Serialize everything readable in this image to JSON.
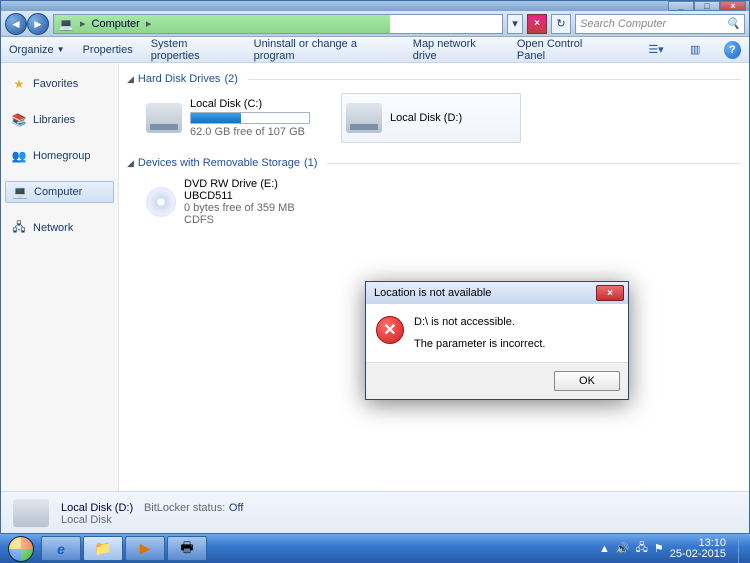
{
  "window_controls": {
    "min": "_",
    "max": "□",
    "close": "×"
  },
  "nav": {
    "back": "◄",
    "forward": "►",
    "crumbs": [
      "Computer"
    ],
    "refresh": "↻",
    "stop": "×"
  },
  "search": {
    "placeholder": "Search Computer",
    "icon": "🔍"
  },
  "toolbar": {
    "organize": "Organize",
    "properties": "Properties",
    "system_properties": "System properties",
    "uninstall": "Uninstall or change a program",
    "map_drive": "Map network drive",
    "control_panel": "Open Control Panel",
    "help": "?"
  },
  "sidebar": {
    "favorites": {
      "label": "Favorites",
      "icon": "★"
    },
    "libraries": {
      "label": "Libraries",
      "icon": "📚"
    },
    "homegroup": {
      "label": "Homegroup",
      "icon": "👥"
    },
    "computer": {
      "label": "Computer",
      "icon": "💻"
    },
    "network": {
      "label": "Network",
      "icon": "🖧"
    }
  },
  "groups": {
    "hdd": {
      "label": "Hard Disk Drives",
      "count": "(2)"
    },
    "removable": {
      "label": "Devices with Removable Storage",
      "count": "(1)"
    }
  },
  "drives": {
    "c": {
      "name": "Local Disk (C:)",
      "free": "62.0 GB free of 107 GB",
      "fill_pct": 42
    },
    "d": {
      "name": "Local Disk (D:)"
    },
    "dvd": {
      "name": "DVD RW Drive (E:) UBCD511",
      "free": "0 bytes free of 359 MB",
      "fs": "CDFS"
    }
  },
  "dialog": {
    "title": "Location is not available",
    "line1": "D:\\ is not accessible.",
    "line2": "The parameter is incorrect.",
    "ok": "OK",
    "close": "×",
    "err": "✕"
  },
  "status": {
    "title": "Local Disk (D:)",
    "bitlocker_label": "BitLocker status:",
    "bitlocker_value": "Off",
    "type": "Local Disk"
  },
  "taskbar": {
    "ie": "e",
    "explorer": "📁",
    "media": "▶",
    "other": "🖶"
  },
  "tray": {
    "up": "▲",
    "vol": "🔊",
    "net": "🖧",
    "flag": "⚑",
    "time": "13:10",
    "date": "25-02-2015"
  }
}
